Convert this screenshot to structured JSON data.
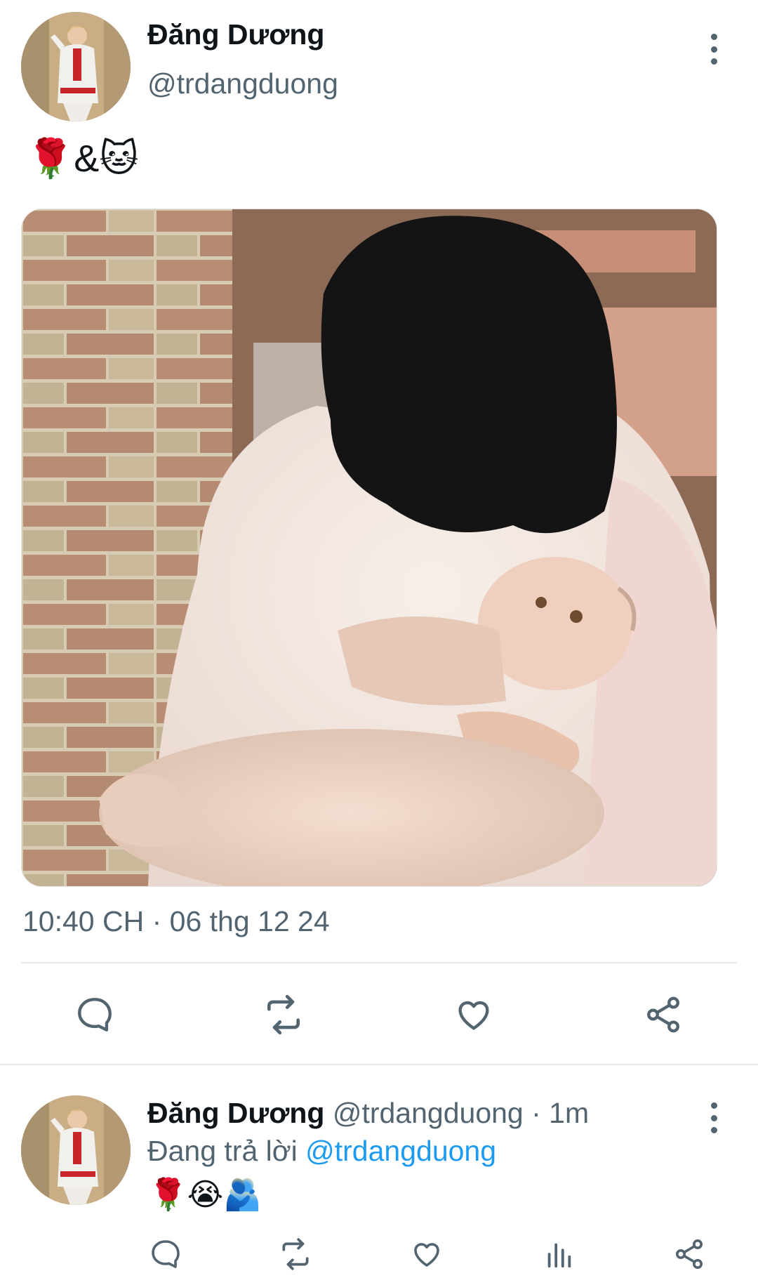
{
  "main_tweet": {
    "author": {
      "name": "Đăng Dương",
      "handle": "@trdangduong",
      "avatar_icon": "profile-photo"
    },
    "more_icon": "more-vertical-icon",
    "text": "🌹&🐱",
    "media": {
      "description_icon": "photo-person-holding-cat"
    },
    "timestamp": "10:40 CH · 06 thg 12 24",
    "actions": [
      {
        "name": "reply",
        "icon": "reply-icon"
      },
      {
        "name": "retweet",
        "icon": "retweet-icon"
      },
      {
        "name": "like",
        "icon": "heart-icon"
      },
      {
        "name": "share",
        "icon": "share-icon"
      }
    ]
  },
  "reply_tweet": {
    "author": {
      "name": "Đăng Dương",
      "handle": "@trdangduong",
      "time": "· 1m"
    },
    "replying_to_prefix": "Đang trả lời ",
    "replying_to_handle": "@trdangduong",
    "text": "🌹😭🫂",
    "actions": [
      {
        "name": "reply",
        "icon": "reply-icon"
      },
      {
        "name": "retweet",
        "icon": "retweet-icon"
      },
      {
        "name": "like",
        "icon": "heart-icon"
      },
      {
        "name": "views",
        "icon": "views-icon"
      },
      {
        "name": "share",
        "icon": "share-icon"
      }
    ]
  },
  "colors": {
    "accent": "#1d9bf0",
    "secondary_text": "#536471",
    "divider": "#e7e9ea"
  }
}
